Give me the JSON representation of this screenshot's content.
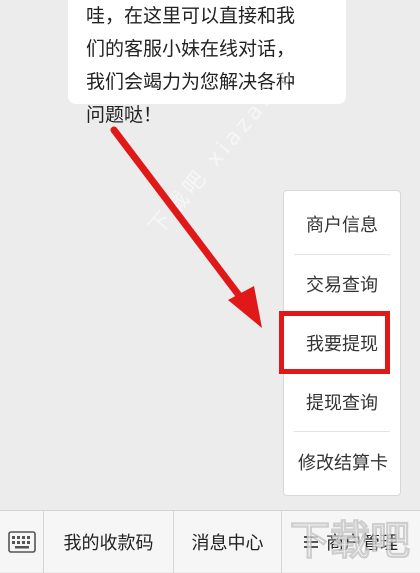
{
  "chat": {
    "lines": [
      "哇，在这里可以直接和我",
      "们的客服小妹在线对话，",
      "我们会竭力为您解决各种",
      "问题哒！"
    ]
  },
  "menu": {
    "items": [
      {
        "label": "商户信息"
      },
      {
        "label": "交易查询"
      },
      {
        "label": "我要提现"
      },
      {
        "label": "提现查询"
      },
      {
        "label": "修改结算卡"
      }
    ]
  },
  "bottom_bar": {
    "tabs": [
      {
        "label": "我的收款码"
      },
      {
        "label": "消息中心"
      },
      {
        "label": "商户管理"
      }
    ]
  },
  "watermark": {
    "diagonal_text": "下载吧 xiazaiba",
    "logo_text": "下载吧"
  },
  "colors": {
    "highlight": "#e01818",
    "arrow": "#e01818",
    "background": "#ececec"
  },
  "icons": {
    "keyboard": "keyboard-icon",
    "menu": "hamburger-icon"
  }
}
